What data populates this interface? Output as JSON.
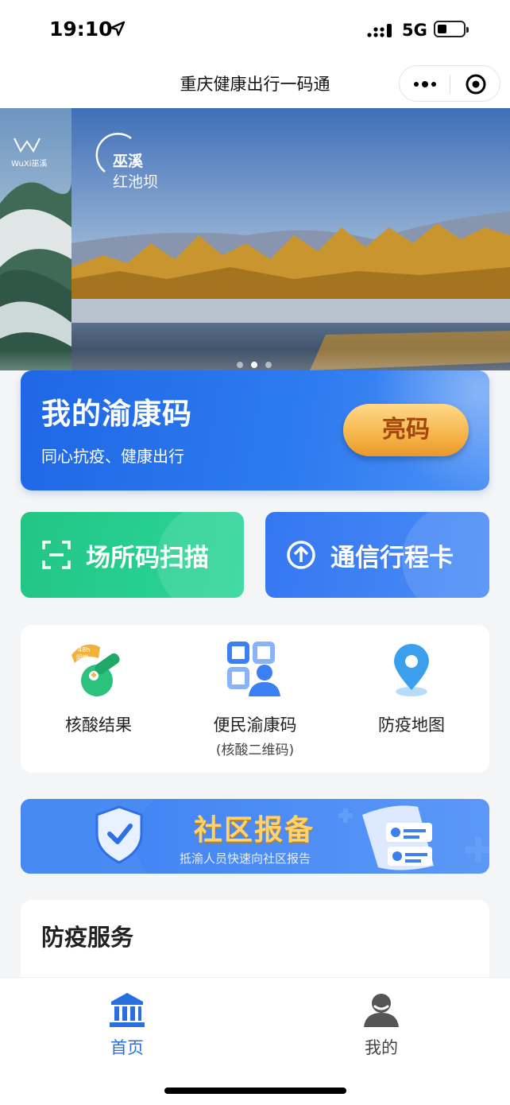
{
  "status": {
    "time": "19:10",
    "network": "5G"
  },
  "nav": {
    "title": "重庆健康出行一码通"
  },
  "banner": {
    "brand_text": "WuXi巫溪",
    "county": "巫溪",
    "place": "红池坝",
    "slides": 3,
    "active_slide": 2
  },
  "health_code": {
    "title": "我的渝康码",
    "subtitle": "同心抗疫、健康出行",
    "show_button": "亮码"
  },
  "quick_actions": {
    "scan_label": "场所码扫描",
    "trip_label": "通信行程卡"
  },
  "services_grid": {
    "items": [
      {
        "label": "核酸结果",
        "badge_top": "48h",
        "badge_bottom": "阴性"
      },
      {
        "label": "便民渝康码",
        "sub": "(核酸二维码)"
      },
      {
        "label": "防疫地图"
      }
    ]
  },
  "report_banner": {
    "title": "社区报备",
    "subtitle": "抵渝人员快速向社区报告"
  },
  "epidemic_services": {
    "title": "防疫服务"
  },
  "tabbar": {
    "home_label": "首页",
    "me_label": "我的",
    "active_color": "#2a6fe0",
    "inactive_color": "#444444"
  },
  "colors": {
    "primary_blue": "#1f67e6",
    "green": "#22c683",
    "gold": "#f5b54a"
  }
}
